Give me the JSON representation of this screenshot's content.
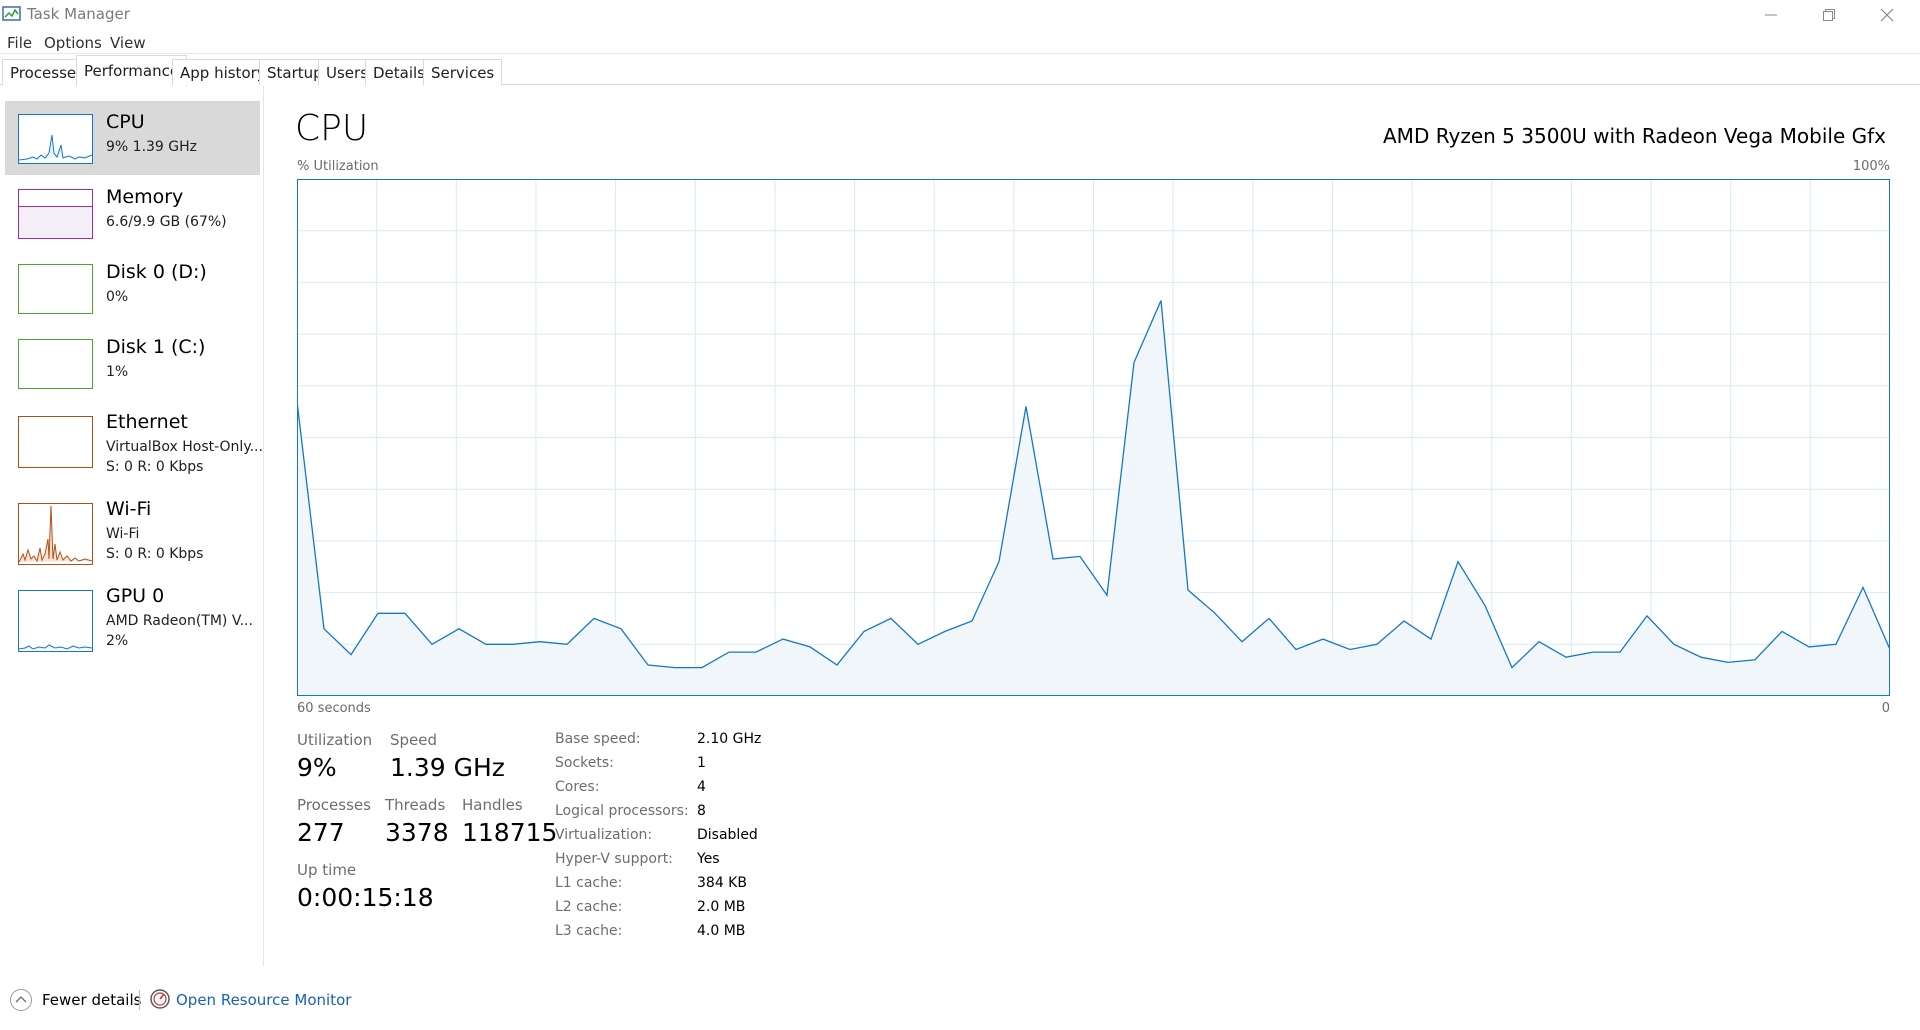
{
  "window": {
    "title": "Task Manager",
    "icon": "task-manager-icon"
  },
  "menu": [
    "File",
    "Options",
    "View"
  ],
  "tabs": [
    "Processes",
    "Performance",
    "App history",
    "Startup",
    "Users",
    "Details",
    "Services"
  ],
  "active_tab": "Performance",
  "sidebar": [
    {
      "name": "CPU",
      "lines": [
        "9%  1.39 GHz"
      ],
      "color": "#1478c8",
      "selected": true
    },
    {
      "name": "Memory",
      "lines": [
        "6.6/9.9 GB (67%)"
      ],
      "color": "#a02ab4",
      "selected": false
    },
    {
      "name": "Disk 0 (D:)",
      "lines": [
        "0%"
      ],
      "color": "#4aa832",
      "selected": false
    },
    {
      "name": "Disk 1 (C:)",
      "lines": [
        "1%"
      ],
      "color": "#4aa832",
      "selected": false
    },
    {
      "name": "Ethernet",
      "lines": [
        "VirtualBox Host-Only...",
        "S: 0  R: 0 Kbps"
      ],
      "color": "#b45014",
      "selected": false
    },
    {
      "name": "Wi-Fi",
      "lines": [
        "Wi-Fi",
        "S: 0  R: 0 Kbps"
      ],
      "color": "#b45014",
      "selected": false
    },
    {
      "name": "GPU 0",
      "lines": [
        "AMD Radeon(TM) V...",
        "2%"
      ],
      "color": "#1478c8",
      "selected": false
    }
  ],
  "main": {
    "title": "CPU",
    "model": "AMD Ryzen 5 3500U with Radeon Vega Mobile Gfx",
    "graph_ylabel": "% Utilization",
    "graph_ymax_label": "100%",
    "graph_xlabel": "60 seconds",
    "graph_xmin_label": "0"
  },
  "chart_data": {
    "type": "area",
    "x_label": "60 seconds",
    "y_label": "% Utilization",
    "ylim": [
      0,
      100
    ],
    "grid": true,
    "color": "#1478c8",
    "fill": "#f1f6fb",
    "values": [
      57,
      13,
      8,
      16,
      16,
      10,
      13,
      10,
      10,
      10.5,
      10,
      15,
      13,
      6,
      5.5,
      5.5,
      8.5,
      8.5,
      11,
      9.5,
      6,
      12.5,
      15,
      10,
      12.5,
      14.5,
      26,
      56,
      26.5,
      27,
      19.5,
      64.5,
      76.5,
      20.5,
      16,
      10.5,
      15,
      9,
      11,
      9,
      10,
      14.5,
      11,
      26,
      17.5,
      5.5,
      10.5,
      7.5,
      8.5,
      8.5,
      15.5,
      10,
      7.5,
      6.5,
      7,
      12.5,
      9.5,
      10,
      21,
      9
    ]
  },
  "stats": {
    "utilization_label": "Utilization",
    "utilization": "9%",
    "speed_label": "Speed",
    "speed": "1.39 GHz",
    "processes_label": "Processes",
    "processes": "277",
    "threads_label": "Threads",
    "threads": "3378",
    "handles_label": "Handles",
    "handles": "118715",
    "uptime_label": "Up time",
    "uptime": "0:00:15:18"
  },
  "specs": [
    {
      "key": "Base speed:",
      "value": "2.10 GHz"
    },
    {
      "key": "Sockets:",
      "value": "1"
    },
    {
      "key": "Cores:",
      "value": "4"
    },
    {
      "key": "Logical processors:",
      "value": "8"
    },
    {
      "key": "Virtualization:",
      "value": "Disabled"
    },
    {
      "key": "Hyper-V support:",
      "value": "Yes"
    },
    {
      "key": "L1 cache:",
      "value": "384 KB"
    },
    {
      "key": "L2 cache:",
      "value": "2.0 MB"
    },
    {
      "key": "L3 cache:",
      "value": "4.0 MB"
    }
  ],
  "footer": {
    "fewer_details": "Fewer details",
    "open_resource_monitor": "Open Resource Monitor"
  }
}
